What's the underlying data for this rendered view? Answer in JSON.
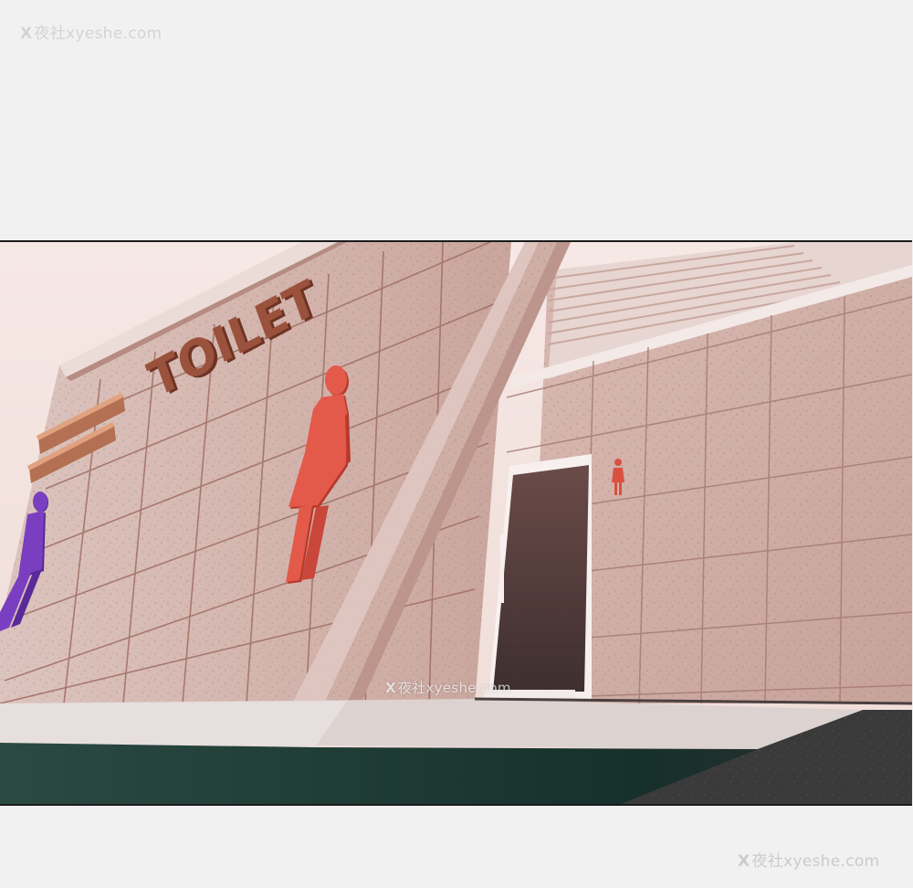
{
  "watermarks": {
    "top": "夜社xyeshe.com",
    "middle": "夜社xyeshe.com",
    "bottom": "夜社xyeshe.com",
    "mark": "X"
  },
  "scene": {
    "sign_text": "TOILET",
    "colors": {
      "sky": "#f4e4e0",
      "wall": "#d8bcb5",
      "wall_shadow": "#c9aaa2",
      "grout": "#a2756c",
      "sign": "#8a4a38",
      "female_icon": "#e35a4a",
      "male_icon": "#7a3fc0",
      "stripes": "#c98c6a",
      "doorway": "#5a3e3e",
      "ground_dark": "#1f3a33",
      "ramp": "#dcd3d1"
    },
    "icons": [
      "female-restroom-icon",
      "male-restroom-icon",
      "small-female-restroom-icon"
    ]
  }
}
